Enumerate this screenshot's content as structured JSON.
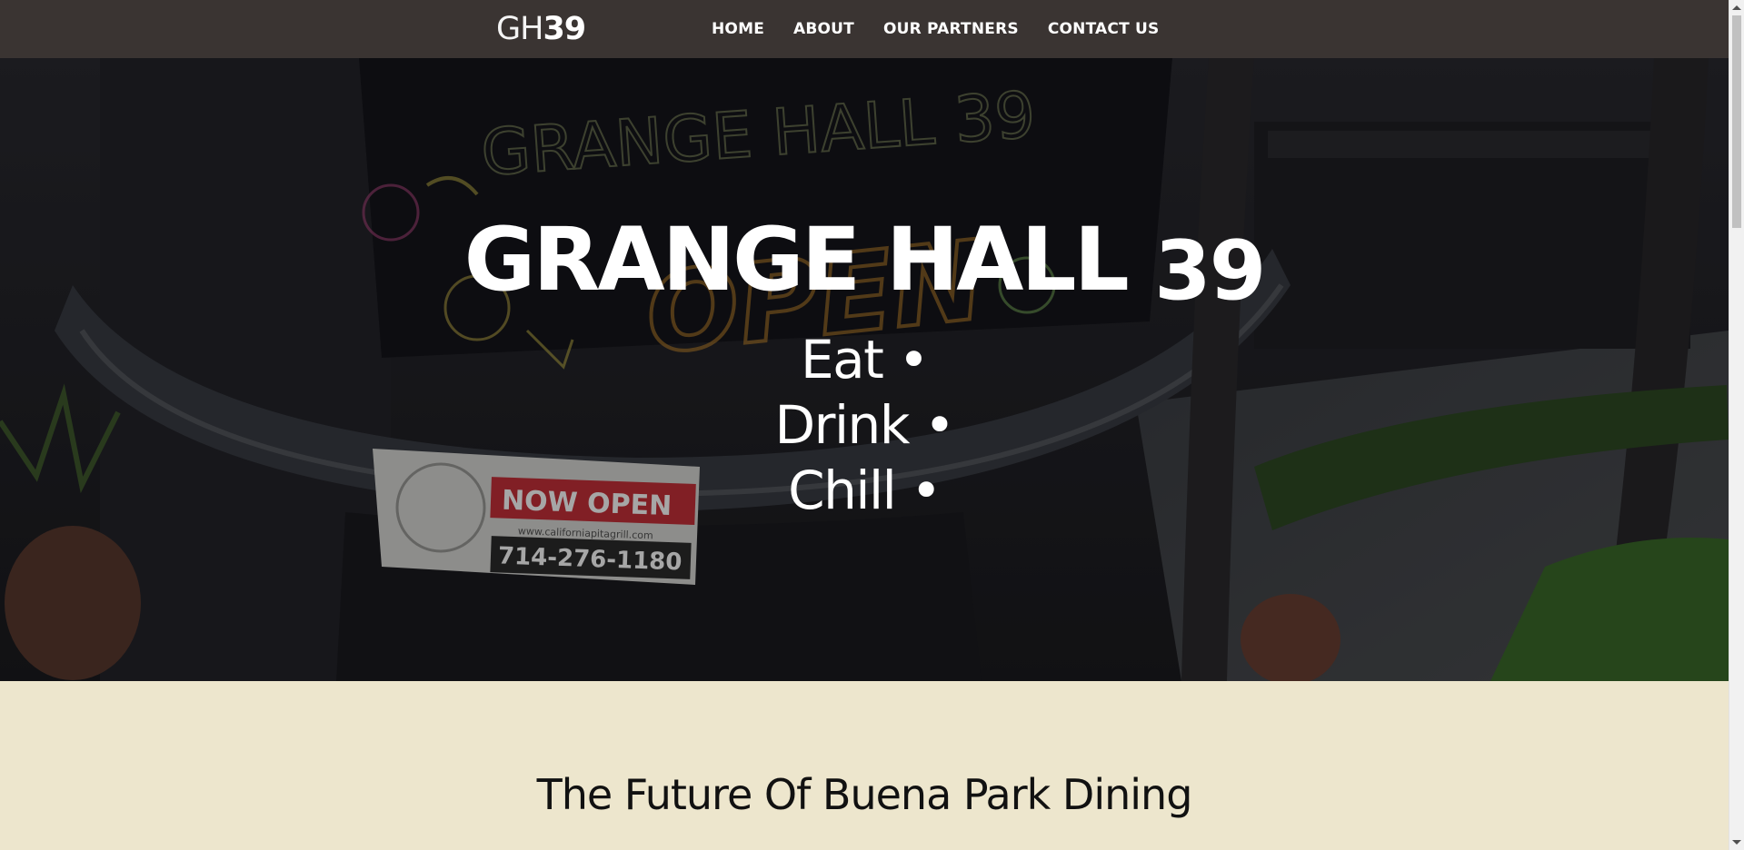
{
  "header": {
    "logo_thin": "GH",
    "logo_bold": "39",
    "nav": [
      "HOME",
      "ABOUT",
      "OUR PARTNERS",
      "CONTACT US"
    ]
  },
  "hero": {
    "title_main": "GRANGE HALL",
    "title_num": "39",
    "taglines": [
      "Eat •",
      "Drink •",
      "Chill •"
    ],
    "banner_text": "GRANGE HALL 39",
    "open_sign": "OPEN",
    "now_open": "NOW OPEN",
    "website": "www.californiapitagrill.com",
    "phone": "714-276-1180"
  },
  "section": {
    "heading": "The Future Of Buena Park Dining"
  },
  "colors": {
    "header_bg": "#3a3432",
    "section_bg": "#ede6cd",
    "text_dark": "#111111",
    "text_light": "#ffffff"
  }
}
